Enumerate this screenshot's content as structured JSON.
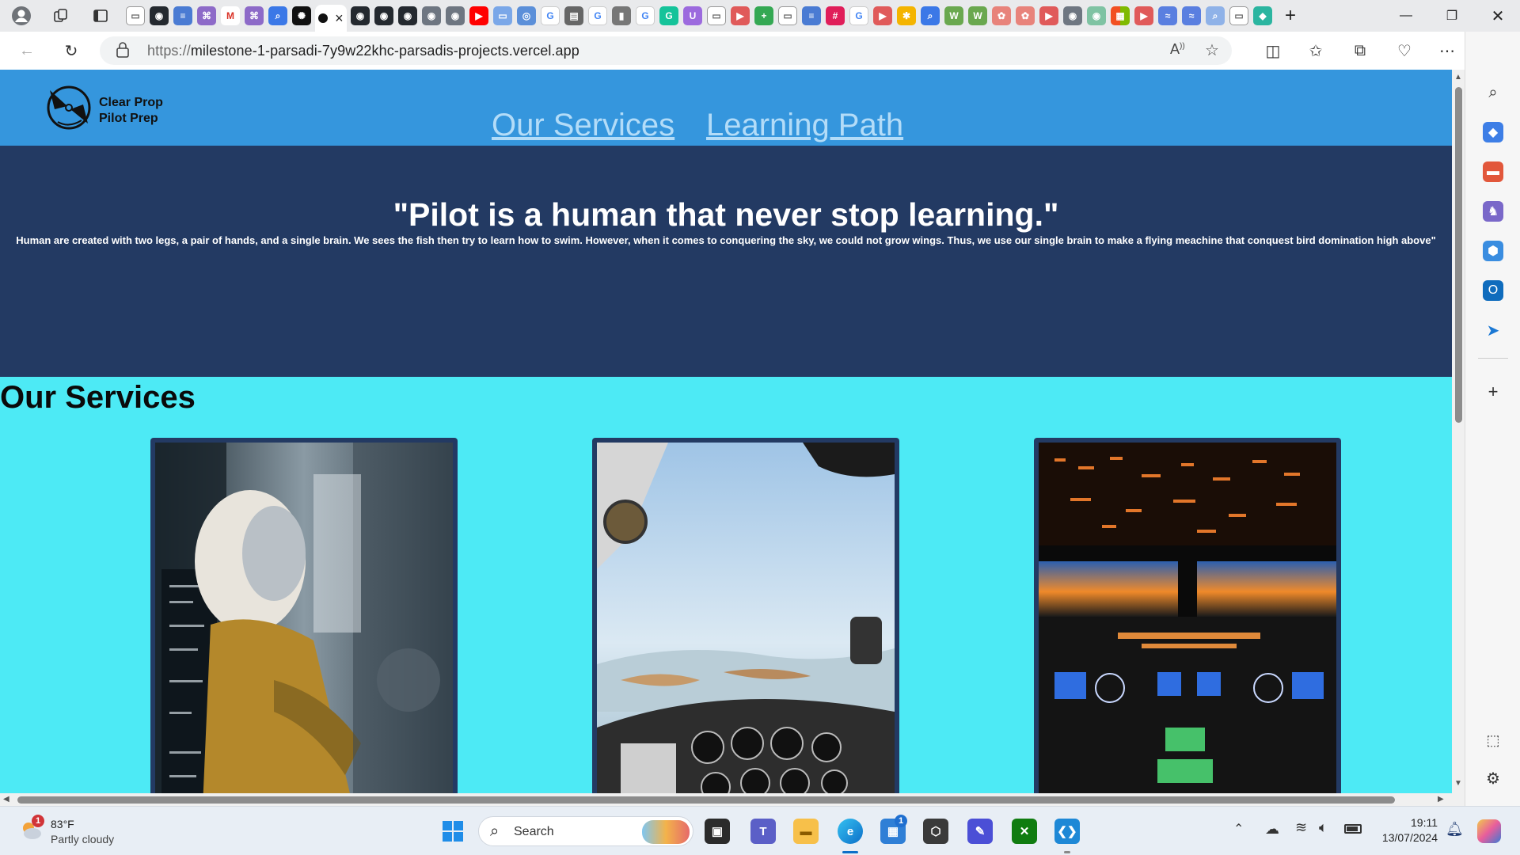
{
  "browser": {
    "url_protocol": "https://",
    "url_host": "milestone-1-parsadi-7y9w22khc-parsadis-projects.vercel.app",
    "tab_close": "×",
    "new_tab": "+"
  },
  "site": {
    "brand_line1": "Clear Prop",
    "brand_line2": "Pilot Prep",
    "nav": [
      "Our Services",
      "Learning Path"
    ],
    "hero_title": "\"Pilot is a human that never stop learning.\"",
    "hero_text": "Human are created with two legs, a pair of hands, and a single brain. We sees the fish then try to learn how to swim. However, when it comes to conquering the sky, we could not grow wings. Thus, we use our single brain to make a flying meachine that conquest bird domination high above\"",
    "services_title": "Our Services"
  },
  "taskbar": {
    "weather_temp": "83°F",
    "weather_desc": "Partly cloudy",
    "weather_badge": "1",
    "search_placeholder": "Search",
    "store_badge": "1",
    "time": "19:11",
    "date": "13/07/2024"
  },
  "colors": {
    "header_bg": "#3596dd",
    "hero_bg": "#233a63",
    "page_bg": "#4deaf5",
    "nav_link": "#b3dcf8"
  }
}
